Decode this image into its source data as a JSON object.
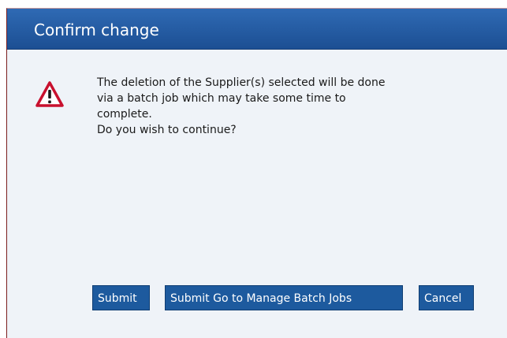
{
  "dialog": {
    "title": "Confirm change",
    "icon": "warning-icon",
    "message_lines": [
      "The deletion of the Supplier(s) selected will be done",
      "via a batch job which may take some time to",
      "complete.",
      "Do you wish to continue?"
    ]
  },
  "buttons": {
    "submit": "Submit",
    "submit_manage": "Submit Go to Manage Batch Jobs",
    "cancel": "Cancel"
  },
  "colors": {
    "titlebar": "#1f56a0",
    "button": "#1d5a9e",
    "warning": "#c8102e"
  }
}
